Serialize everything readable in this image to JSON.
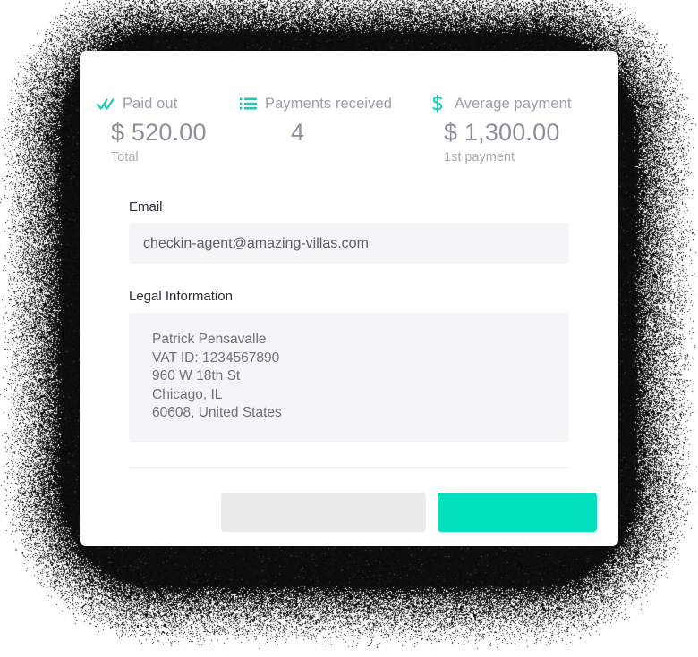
{
  "stats": [
    {
      "icon": "double-check-icon",
      "label": "Paid out",
      "value": "$ 520.00",
      "sub": "Total"
    },
    {
      "icon": "list-icon",
      "label": "Payments received",
      "value": "4",
      "sub": ""
    },
    {
      "icon": "dollar-sign-icon",
      "label": "Average payment",
      "value": "$ 1,300.00",
      "sub": "1st payment"
    }
  ],
  "email": {
    "label": "Email",
    "value": "checkin-agent@amazing-villas.com",
    "placeholder": "Email"
  },
  "legal": {
    "label": "Legal Information",
    "lines": [
      "Patrick Pensavalle",
      "VAT ID: 1234567890",
      "960 W 18th St",
      "Chicago, IL",
      "60608, United States"
    ]
  },
  "actions": {
    "secondary_label": "",
    "primary_label": ""
  },
  "colors": {
    "accent": "#00e0bc",
    "icon_accent": "#16cbb0",
    "value_text": "#8a909a",
    "label_text": "#9aa0a8",
    "field_bg": "#f4f5f6",
    "secondary_btn": "#ececec",
    "card_bg": "#ffffff",
    "page_bg": "#ffffff"
  }
}
